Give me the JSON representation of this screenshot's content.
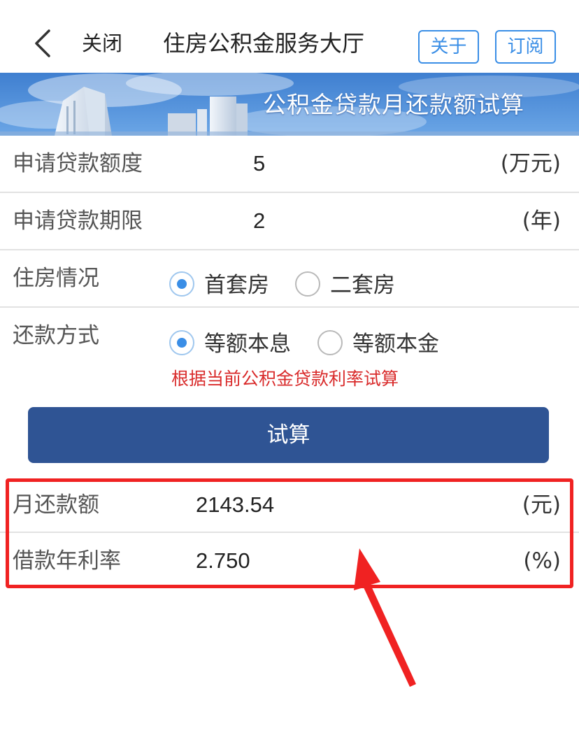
{
  "navbar": {
    "close_label": "关闭",
    "title": "住房公积金服务大厅",
    "about_label": "关于",
    "subscribe_label": "订阅"
  },
  "banner": {
    "title": "公积金贷款月还款额试算"
  },
  "form": {
    "loan_amount": {
      "label": "申请贷款额度",
      "value": "5",
      "unit": "(万元)"
    },
    "loan_term": {
      "label": "申请贷款期限",
      "value": "2",
      "unit": "(年)"
    },
    "housing": {
      "label": "住房情况",
      "options": [
        {
          "label": "首套房",
          "checked": true
        },
        {
          "label": "二套房",
          "checked": false
        }
      ]
    },
    "repayment": {
      "label": "还款方式",
      "options": [
        {
          "label": "等额本息",
          "checked": true
        },
        {
          "label": "等额本金",
          "checked": false
        }
      ],
      "hint": "根据当前公积金贷款利率试算"
    },
    "calculate_label": "试算"
  },
  "results": {
    "monthly_payment": {
      "label": "月还款额",
      "value": "2143.54",
      "unit": "(元)"
    },
    "annual_rate": {
      "label": "借款年利率",
      "value": "2.750",
      "unit": "(%)"
    }
  },
  "colors": {
    "accent": "#3a8ee6",
    "primary_button": "#2f5494",
    "hint": "#d92b2b",
    "annotation": "#f02222"
  }
}
